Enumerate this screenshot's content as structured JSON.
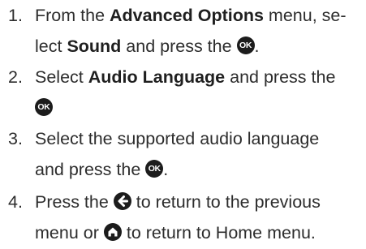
{
  "steps": [
    {
      "number": "1.",
      "lines": [
        [
          "From the ",
          "Advanced Options",
          " menu, se-"
        ],
        [
          "lect ",
          "Sound",
          " and press the ",
          "OK",
          "."
        ]
      ]
    },
    {
      "number": "2.",
      "lines": [
        [
          "Select ",
          "Audio Language",
          " and press the"
        ],
        [
          "OK"
        ]
      ]
    },
    {
      "number": "3.",
      "lines": [
        [
          "Select the supported audio language"
        ],
        [
          "and press the ",
          "OK",
          "."
        ]
      ]
    },
    {
      "number": "4.",
      "lines": [
        [
          "Press the ",
          "to return to the previous"
        ],
        [
          "menu or ",
          "to return to Home menu."
        ]
      ]
    }
  ],
  "icons": {
    "ok": "ok-button-icon",
    "back": "back-arrow-icon",
    "home": "home-icon"
  }
}
